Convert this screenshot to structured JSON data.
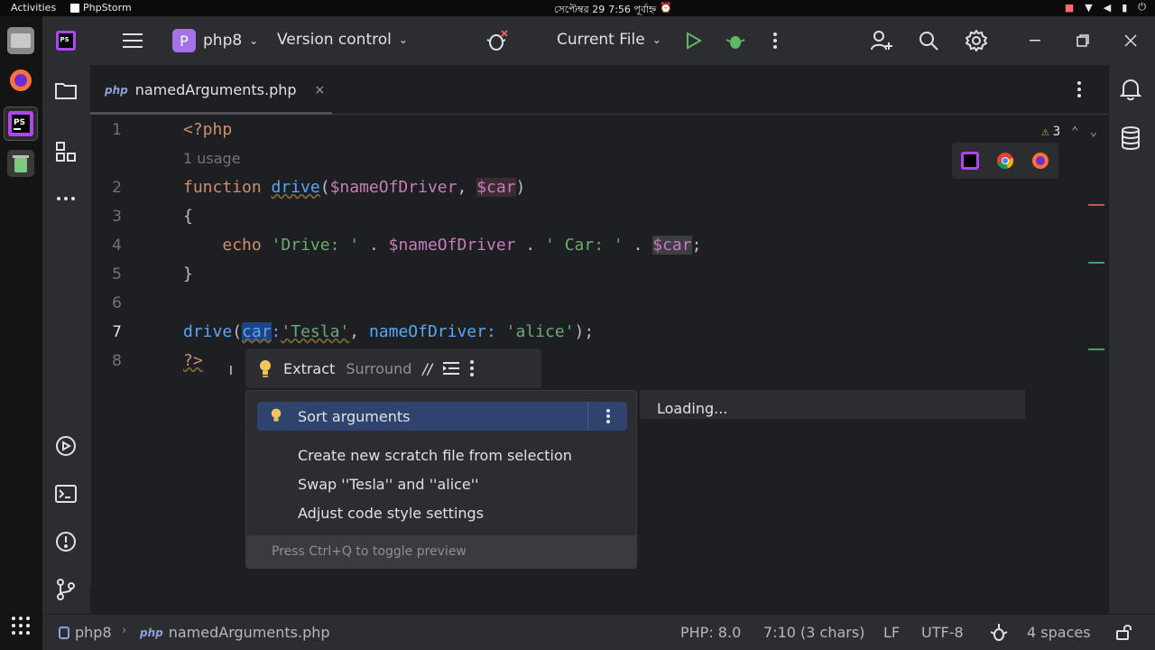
{
  "system_bar": {
    "activities": "Activities",
    "app_name": "PhpStorm",
    "clock_date": "সেপ্টেম্বর 29",
    "clock_time": "7:56 পূর্বাহ্ন"
  },
  "dock": {
    "items": [
      "files-icon",
      "firefox-icon",
      "phpstorm-icon",
      "trash-icon"
    ]
  },
  "toolbar": {
    "project_badge": "P",
    "project_name": "php8",
    "vcs_label": "Version control",
    "run_config": "Current File"
  },
  "tab": {
    "badge": "php",
    "filename": "namedArguments.php",
    "close": "×"
  },
  "editor": {
    "line_numbers": [
      "1",
      "2",
      "3",
      "4",
      "5",
      "6",
      "7",
      "8"
    ],
    "usage_hint": "1 usage",
    "problems_count": "3",
    "code": {
      "l1": "<?php",
      "l2_kw": "function",
      "l2_fn": "drive",
      "l2_p1": "$nameOfDriver",
      "l2_p2": "$car",
      "l3": "{",
      "l4_kw": "echo",
      "l4_s1": "'Drive: '",
      "l4_dot1": " . ",
      "l4_v1": "$nameOfDriver",
      "l4_dot2": " . ",
      "l4_s2": "' Car: '",
      "l4_dot3": " . ",
      "l4_v2": "$car",
      "l5": "}",
      "l7_fn": "drive",
      "l7_n1": "car",
      "l7_s1": "'Tesla'",
      "l7_n2": "nameOfDriver:",
      "l7_s2": "'alice'",
      "l8": "?>"
    }
  },
  "floating_bar": {
    "extract": "Extract",
    "surround": "Surround"
  },
  "intention_popup": {
    "items": [
      "Sort arguments",
      "Create new scratch file from selection",
      "Swap ''Tesla'' and ''alice''",
      "Adjust code style settings"
    ],
    "footer": "Press Ctrl+Q to toggle preview"
  },
  "preview": {
    "text": "Loading..."
  },
  "status_bar": {
    "project": "php8",
    "badge": "php",
    "file": "namedArguments.php",
    "php_version": "PHP: 8.0",
    "position": "7:10 (3 chars)",
    "line_sep": "LF",
    "encoding": "UTF-8",
    "indent": "4 spaces"
  },
  "colors": {
    "keyword": "#cf8e6d",
    "function": "#56a8f5",
    "variable": "#c77dbb",
    "string": "#6aab73",
    "selection": "#2e436e"
  }
}
